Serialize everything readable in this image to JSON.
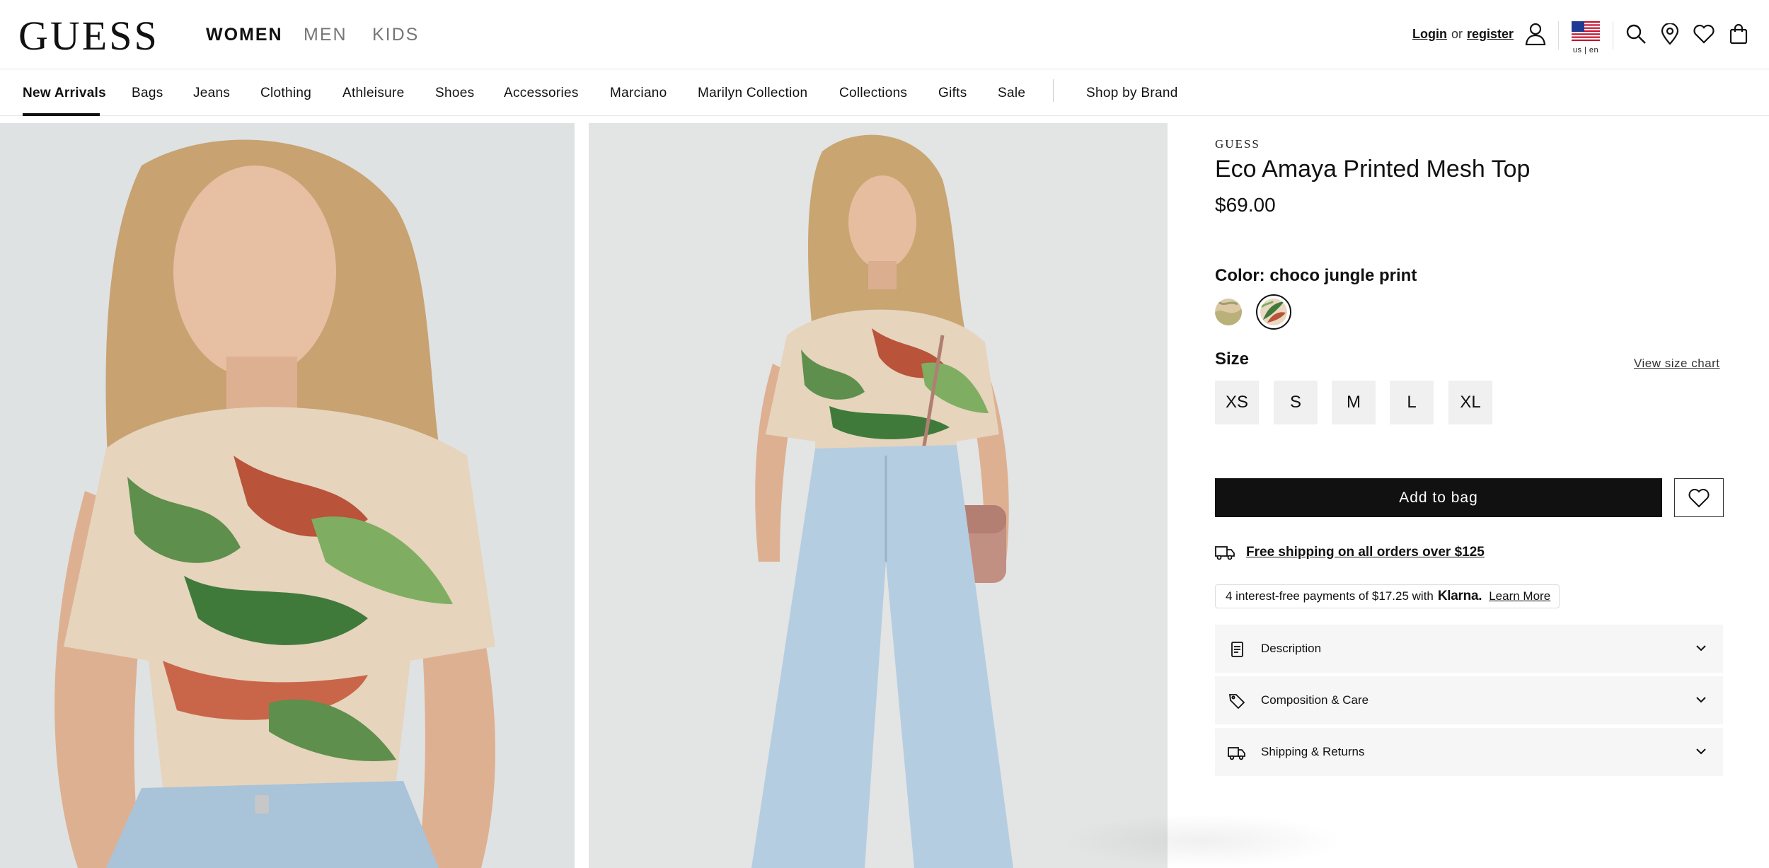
{
  "header": {
    "logo": "GUESS",
    "genders": [
      {
        "label": "WOMEN",
        "active": true
      },
      {
        "label": "MEN",
        "active": false
      },
      {
        "label": "KIDS",
        "active": false
      }
    ],
    "login_label": "Login",
    "or_label": "or",
    "register_label": "register",
    "locale": "us | en",
    "icons": [
      "account-icon",
      "us-flag-icon",
      "search-icon",
      "store-locator-icon",
      "wishlist-icon",
      "shopping-bag-icon"
    ]
  },
  "nav": {
    "items": [
      {
        "label": "New Arrivals",
        "active": true
      },
      {
        "label": "Bags"
      },
      {
        "label": "Jeans"
      },
      {
        "label": "Clothing"
      },
      {
        "label": "Athleisure"
      },
      {
        "label": "Shoes"
      },
      {
        "label": "Accessories"
      },
      {
        "label": "Marciano"
      },
      {
        "label": "Marilyn Collection"
      },
      {
        "label": "Collections"
      },
      {
        "label": "Gifts"
      },
      {
        "label": "Sale"
      },
      {
        "label": "Shop by Brand"
      }
    ]
  },
  "product": {
    "brand": "GUESS",
    "title": "Eco Amaya Printed Mesh Top",
    "price": "$69.00",
    "color_prefix": "Color:",
    "color_value": "choco jungle print",
    "swatches": [
      {
        "name": "beige print",
        "color": "#d9c39a",
        "selected": false
      },
      {
        "name": "choco jungle print",
        "color": "#c9a27a",
        "selected": true
      }
    ],
    "size_label": "Size",
    "size_chart_label": "View size chart",
    "sizes": [
      "XS",
      "S",
      "M",
      "L",
      "XL"
    ],
    "add_to_bag_label": "Add to bag",
    "shipping_text": "Free shipping on all orders over $125",
    "klarna": {
      "prefix": "4 interest-free payments of $17.25 with",
      "brand": "Klarna.",
      "learn_more": "Learn More"
    },
    "accordions": [
      {
        "label": "Description",
        "icon": "document-icon"
      },
      {
        "label": "Composition & Care",
        "icon": "tag-icon"
      },
      {
        "label": "Shipping & Returns",
        "icon": "truck-icon"
      }
    ]
  },
  "colors": {
    "text": "#111111",
    "accent": "#111111",
    "muted": "#777777",
    "panel": "#f6f6f6"
  }
}
